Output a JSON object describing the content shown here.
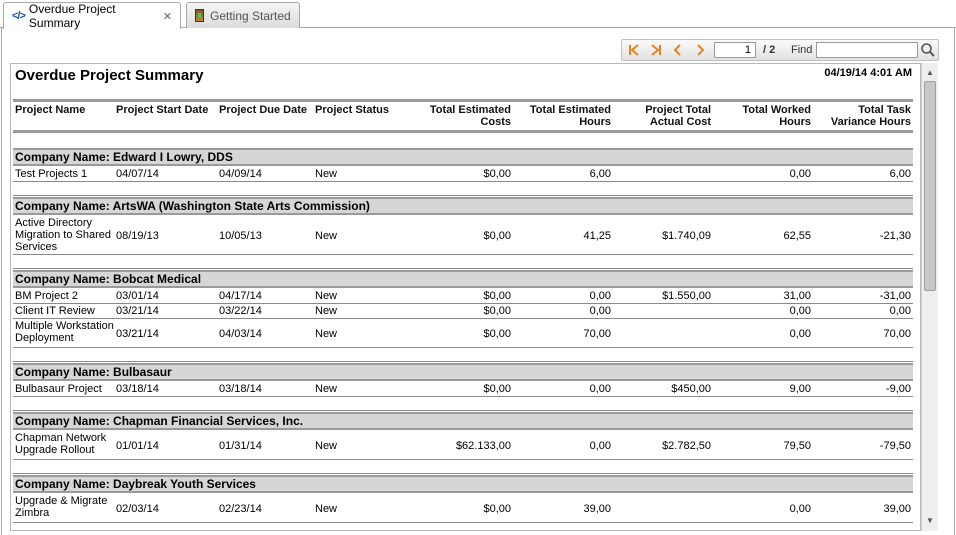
{
  "tabs": [
    {
      "label": "Overdue Project Summary",
      "icon": "code-icon",
      "active": true
    },
    {
      "label": "Getting Started",
      "icon": "traffic-light-icon",
      "active": false
    }
  ],
  "toolbar": {
    "page_value": "1",
    "page_total": "/ 2",
    "find_label": "Find",
    "find_value": "",
    "accent": "#e8821e"
  },
  "report": {
    "title": "Overdue Project Summary",
    "timestamp": "04/19/14 4:01 AM",
    "columns": [
      {
        "line1": "Project Name",
        "line2": ""
      },
      {
        "line1": "Project Start Date",
        "line2": ""
      },
      {
        "line1": "Project Due Date",
        "line2": ""
      },
      {
        "line1": "Project Status",
        "line2": ""
      },
      {
        "line1": "Total Estimated",
        "line2": "Costs"
      },
      {
        "line1": "Total Estimated",
        "line2": "Hours"
      },
      {
        "line1": "Project Total",
        "line2": "Actual Cost"
      },
      {
        "line1": "Total Worked",
        "line2": "Hours"
      },
      {
        "line1": "Total Task",
        "line2": "Variance Hours"
      }
    ],
    "groups": [
      {
        "label": "Company Name:  Edward I Lowry, DDS",
        "rows": [
          {
            "name": [
              "Test Projects 1"
            ],
            "start": "04/07/14",
            "due": "04/09/14",
            "status": "New",
            "est_cost": "$0,00",
            "est_hours": "6,00",
            "actual_cost": "",
            "worked": "0,00",
            "variance": "6,00"
          }
        ]
      },
      {
        "label": "Company Name: ArtsWA (Washington State Arts Commission)",
        "rows": [
          {
            "name": [
              "Active Directory",
              "Migration to Shared",
              "Services"
            ],
            "start": "08/19/13",
            "due": "10/05/13",
            "status": "New",
            "est_cost": "$0,00",
            "est_hours": "41,25",
            "actual_cost": "$1.740,09",
            "worked": "62,55",
            "variance": "-21,30"
          }
        ]
      },
      {
        "label": "Company Name: Bobcat Medical",
        "rows": [
          {
            "name": [
              "BM Project 2"
            ],
            "start": "03/01/14",
            "due": "04/17/14",
            "status": "New",
            "est_cost": "$0,00",
            "est_hours": "0,00",
            "actual_cost": "$1.550,00",
            "worked": "31,00",
            "variance": "-31,00"
          },
          {
            "name": [
              "Client IT Review"
            ],
            "start": "03/21/14",
            "due": "03/22/14",
            "status": "New",
            "est_cost": "$0,00",
            "est_hours": "0,00",
            "actual_cost": "",
            "worked": "0,00",
            "variance": "0,00"
          },
          {
            "name": [
              "Multiple Workstation",
              "Deployment"
            ],
            "start": "03/21/14",
            "due": "04/03/14",
            "status": "New",
            "est_cost": "$0,00",
            "est_hours": "70,00",
            "actual_cost": "",
            "worked": "0,00",
            "variance": "70,00"
          }
        ]
      },
      {
        "label": "Company Name: Bulbasaur",
        "rows": [
          {
            "name": [
              "Bulbasaur Project"
            ],
            "start": "03/18/14",
            "due": "03/18/14",
            "status": "New",
            "est_cost": "$0,00",
            "est_hours": "0,00",
            "actual_cost": "$450,00",
            "worked": "9,00",
            "variance": "-9,00"
          }
        ]
      },
      {
        "label": "Company Name: Chapman Financial Services, Inc.",
        "rows": [
          {
            "name": [
              "Chapman Network",
              "Upgrade Rollout"
            ],
            "start": "01/01/14",
            "due": "01/31/14",
            "status": "New",
            "est_cost": "$62.133,00",
            "est_hours": "0,00",
            "actual_cost": "$2.782,50",
            "worked": "79,50",
            "variance": "-79,50"
          }
        ]
      },
      {
        "label": "Company Name: Daybreak Youth Services",
        "rows": [
          {
            "name": [
              "Upgrade & Migrate",
              "Zimbra"
            ],
            "start": "02/03/14",
            "due": "02/23/14",
            "status": "New",
            "est_cost": "$0,00",
            "est_hours": "39,00",
            "actual_cost": "",
            "worked": "0,00",
            "variance": "39,00"
          }
        ]
      }
    ]
  }
}
